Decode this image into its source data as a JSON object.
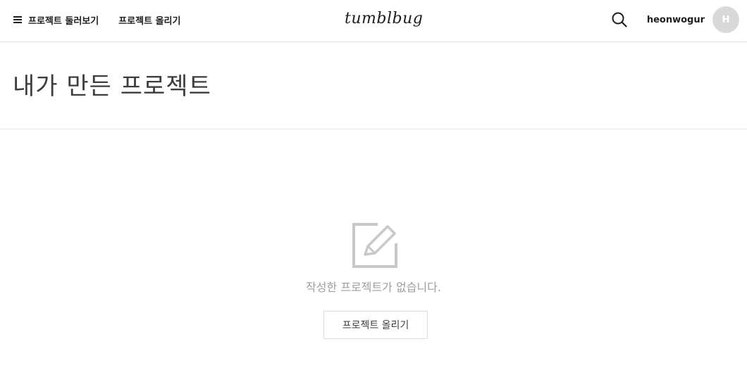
{
  "header": {
    "nav": [
      {
        "label": "프로젝트 둘러보기",
        "icon": "menu-icon"
      },
      {
        "label": "프로젝트 올리기"
      }
    ],
    "logo": "tumblbug",
    "search_icon": "search-icon",
    "username": "heonwogur",
    "avatar_initial": "H"
  },
  "page": {
    "title": "내가 만든 프로젝트"
  },
  "empty_state": {
    "icon": "edit-icon",
    "message": "작성한 프로젝트가 없습니다.",
    "button_label": "프로젝트 올리기"
  },
  "colors": {
    "icon_gray": "#c8c8c8",
    "message_gray": "#9e9e9e",
    "border": "#e6e6e6"
  }
}
